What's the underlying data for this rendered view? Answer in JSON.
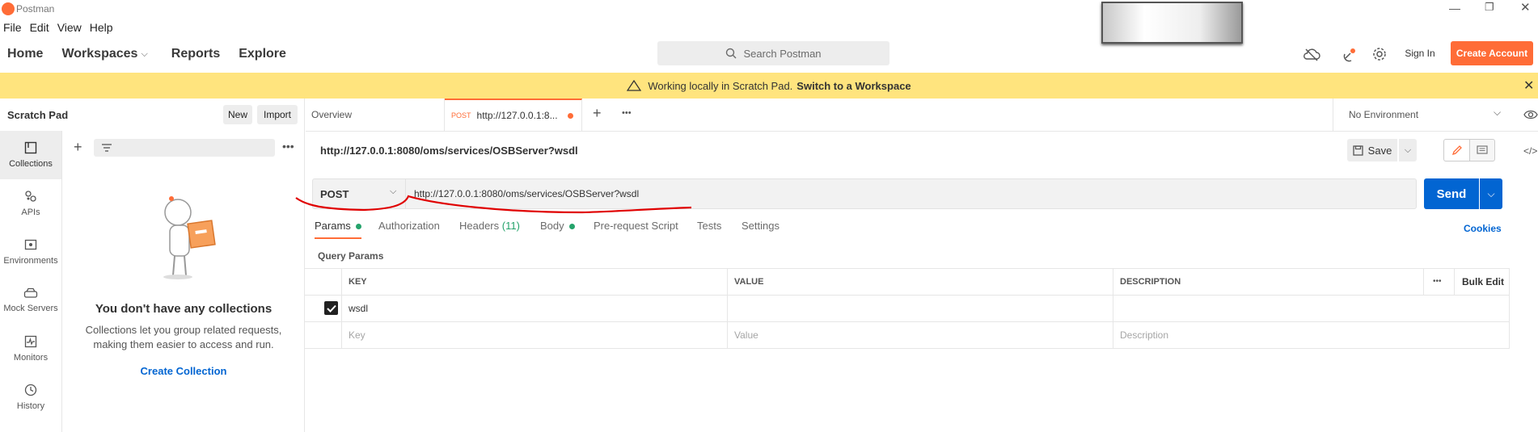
{
  "app": {
    "title": "Postman"
  },
  "menu": [
    "File",
    "Edit",
    "View",
    "Help"
  ],
  "header": {
    "nav": [
      "Home",
      "Workspaces",
      "Reports",
      "Explore"
    ],
    "search_placeholder": "Search Postman",
    "sign_in": "Sign In",
    "create_account": "Create Account"
  },
  "banner": {
    "text": "Working locally in Scratch Pad.",
    "link": "Switch to a Workspace"
  },
  "sidebar": {
    "title": "Scratch Pad",
    "new_label": "New",
    "import_label": "Import",
    "rail": [
      {
        "label": "Collections",
        "icon": "collections-icon"
      },
      {
        "label": "APIs",
        "icon": "apis-icon"
      },
      {
        "label": "Environments",
        "icon": "environments-icon"
      },
      {
        "label": "Mock Servers",
        "icon": "mock-servers-icon"
      },
      {
        "label": "Monitors",
        "icon": "monitors-icon"
      },
      {
        "label": "History",
        "icon": "history-icon"
      }
    ],
    "empty_title": "You don't have any collections",
    "empty_text_1": "Collections let you group related requests,",
    "empty_text_2": "making them easier to access and run.",
    "create_collection": "Create Collection"
  },
  "tabs": {
    "overview": "Overview",
    "active_method": "POST",
    "active_title": "http://127.0.0.1:8...",
    "environment": "No Environment"
  },
  "request": {
    "name": "http://127.0.0.1:8080/oms/services/OSBServer?wsdl",
    "save_label": "Save",
    "method": "POST",
    "url": "http://127.0.0.1:8080/oms/services/OSBServer?wsdl",
    "send_label": "Send",
    "subtabs": [
      {
        "label": "Params",
        "dot": true
      },
      {
        "label": "Authorization",
        "dot": false
      },
      {
        "label": "Headers",
        "count": "(11)",
        "dot": false
      },
      {
        "label": "Body",
        "dot": true
      },
      {
        "label": "Pre-request Script",
        "dot": false
      },
      {
        "label": "Tests",
        "dot": false
      },
      {
        "label": "Settings",
        "dot": false
      }
    ],
    "cookies_label": "Cookies",
    "query_params_label": "Query Params",
    "columns": [
      "KEY",
      "VALUE",
      "DESCRIPTION"
    ],
    "bulk_edit": "Bulk Edit",
    "rows": [
      {
        "key": "wsdl",
        "value": "",
        "description": "",
        "checked": true
      }
    ],
    "placeholders": {
      "key": "Key",
      "value": "Value",
      "description": "Description"
    }
  },
  "colors": {
    "accent": "#ff6c37",
    "send": "#0265d2",
    "banner": "#ffe47e",
    "annotation": "#e00000"
  }
}
